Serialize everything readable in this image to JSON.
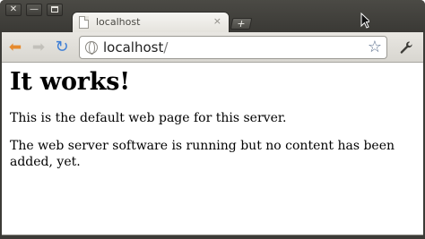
{
  "window": {
    "controls": {
      "close": "✕",
      "minimize": "—",
      "maximize": ""
    }
  },
  "tab": {
    "title": "localhost",
    "close_glyph": "×",
    "new_tab_glyph": "+"
  },
  "toolbar": {
    "back_icon": "⬅",
    "forward_icon": "➡",
    "reload_icon": "↻",
    "url_host": "localhost",
    "url_path": "/",
    "bookmark_icon": "☆",
    "wrench_icon": "🔧"
  },
  "page": {
    "heading": "It works!",
    "paragraph1": "This is the default web page for this server.",
    "paragraph2": "The web server software is running but no content has been added, yet."
  }
}
